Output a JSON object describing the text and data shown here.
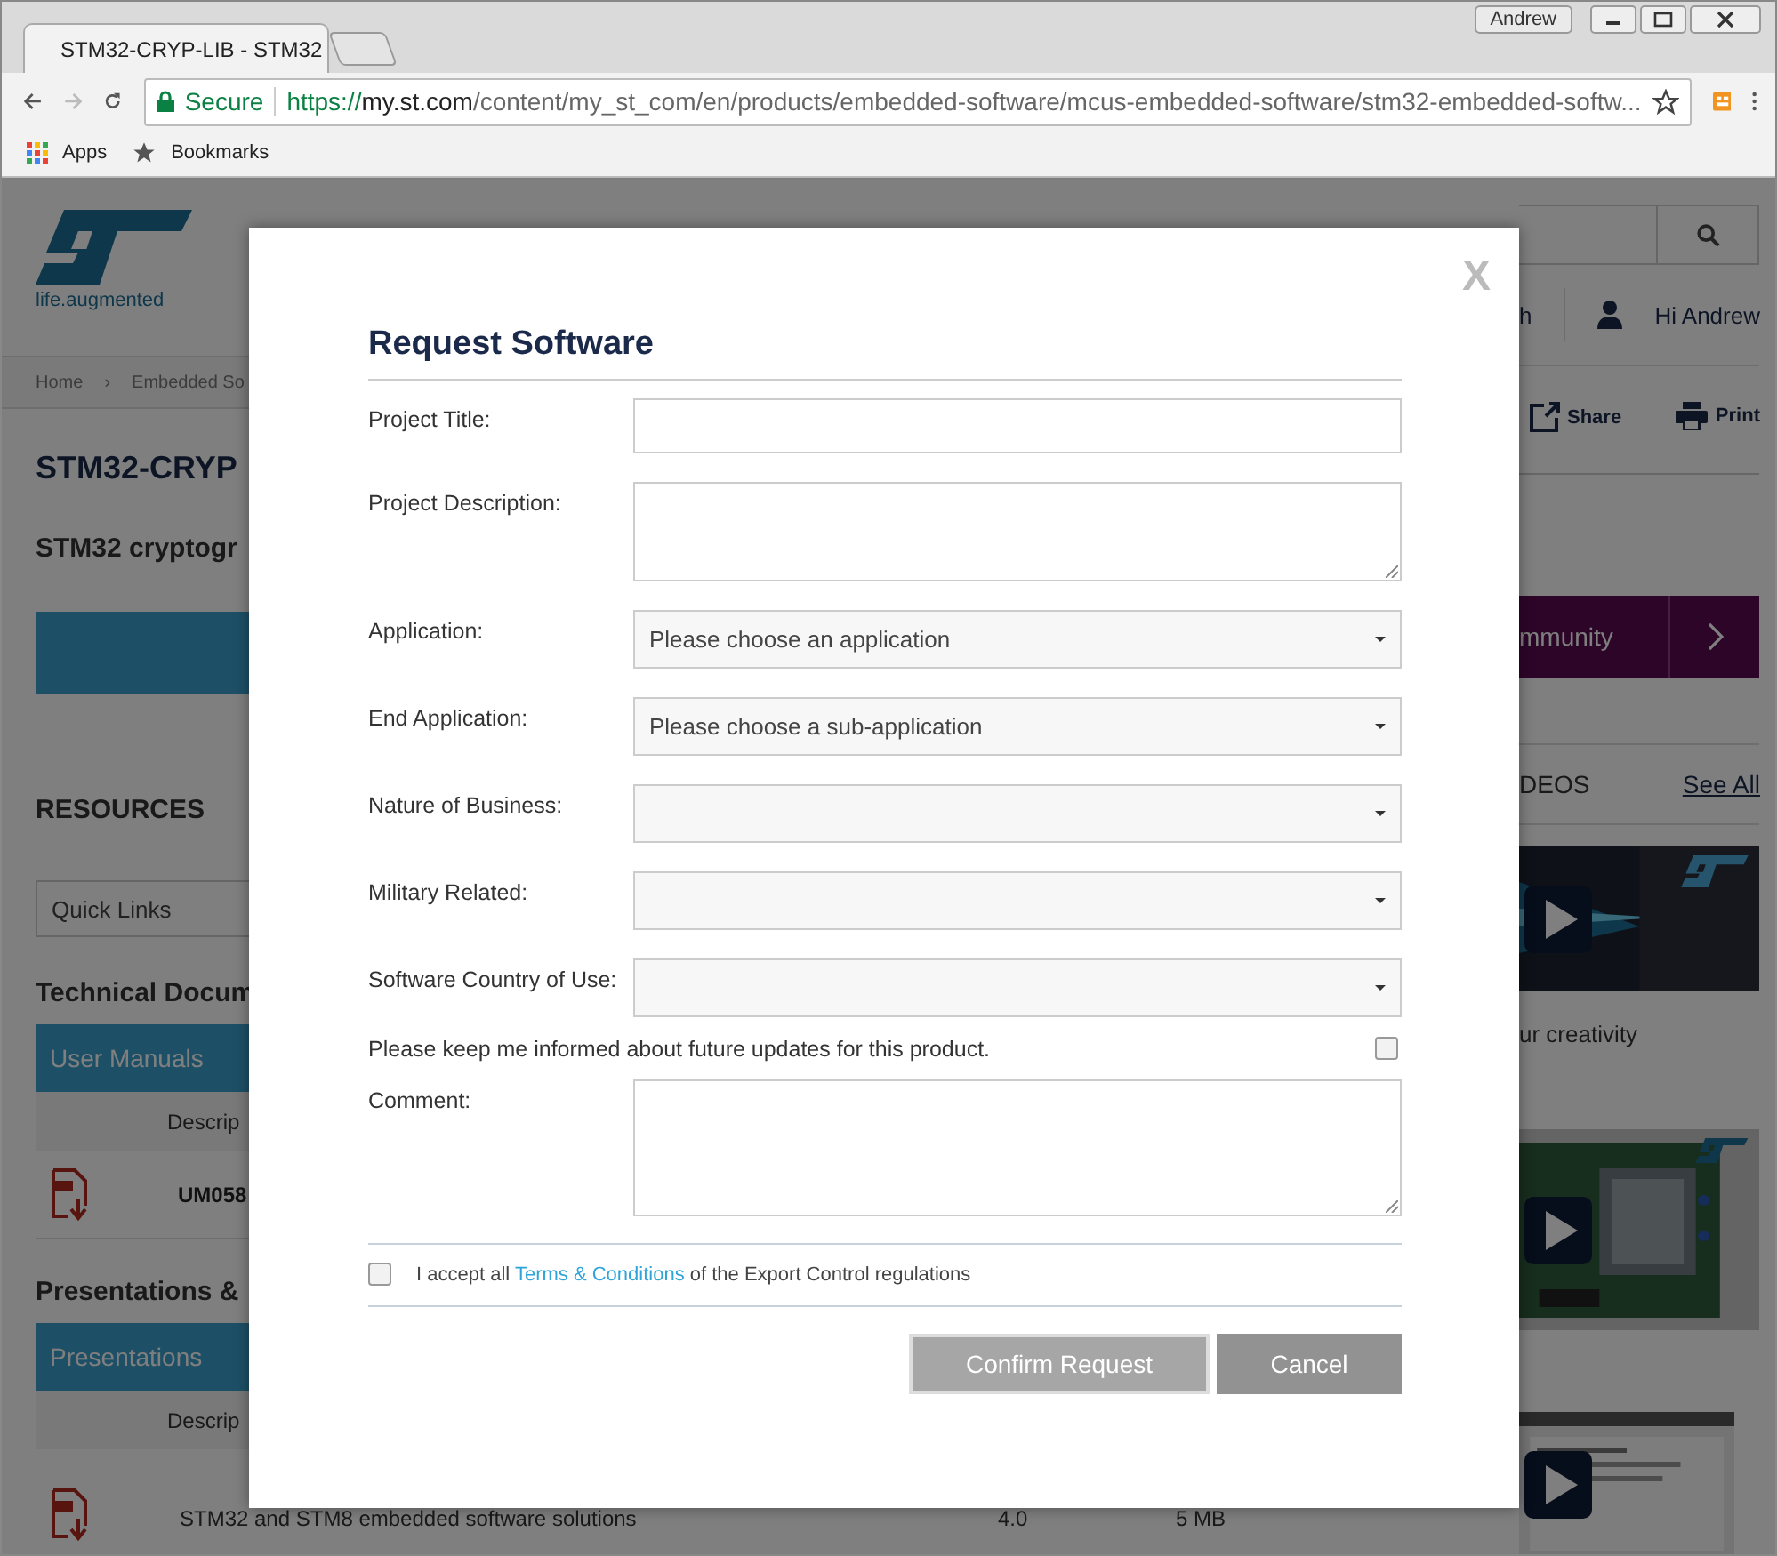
{
  "browser": {
    "tab": {
      "title": "STM32-CRYP-LIB - STM32"
    },
    "profile": "Andrew",
    "address": {
      "secure_label": "Secure",
      "scheme": "https://",
      "host": "my.st.com",
      "path": "/content/my_st_com/en/products/embedded-software/mcus-embedded-software/stm32-embedded-softw..."
    },
    "bookmarks": [
      "Apps",
      "Bookmarks"
    ]
  },
  "page": {
    "logo_tagline": "life.augmented",
    "breadcrumb": {
      "items": [
        "Home",
        "Embedded So"
      ],
      "separator": "›"
    },
    "title": "STM32-CRYP",
    "subtitle": "STM32 cryptogr",
    "resources": "RESOURCES",
    "quick_links": {
      "placeholder": "Quick Links"
    },
    "tech_docs": "Technical Docum",
    "user_manuals": "User Manuals",
    "desc_header_1": "Descrip",
    "doc": "UM058",
    "presentations_heading": "Presentations &",
    "presentations": "Presentations",
    "desc_header_2": "Descrip",
    "bottom_row": {
      "description": "STM32 and STM8 embedded software solutions",
      "version": "4.0",
      "size": "5 MB"
    },
    "search_tail": "h",
    "greeting": "Hi Andrew",
    "share": "Share",
    "print": "Print",
    "community": "mmunity",
    "videos_heading": "DEOS",
    "see_all": "See All",
    "video_caption": "ur creativity"
  },
  "modal": {
    "close": "X",
    "title": "Request Software",
    "fields": [
      {
        "label": "Project Title:",
        "kind": "text"
      },
      {
        "label": "Project Description:",
        "kind": "textarea"
      },
      {
        "label": "Application:",
        "kind": "select",
        "value": "Please choose an application"
      },
      {
        "label": "End Application:",
        "kind": "select",
        "value": "Please choose a sub-application"
      },
      {
        "label": "Nature of Business:",
        "kind": "select"
      },
      {
        "label": "Military Related:",
        "kind": "select"
      },
      {
        "label": "Software Country of Use:",
        "kind": "select"
      },
      {
        "label": "Please keep me informed about future updates for this product.",
        "kind": "checkbox",
        "checked": false
      },
      {
        "label": "Comment:",
        "kind": "textarea"
      }
    ],
    "accept": {
      "before": "I accept all",
      "link": "Terms & Conditions",
      "after": "of the Export Control regulations",
      "checked": false
    },
    "buttons": [
      {
        "label": "Confirm Request",
        "kind": "primary"
      },
      {
        "label": "Cancel",
        "kind": "secondary"
      }
    ]
  }
}
